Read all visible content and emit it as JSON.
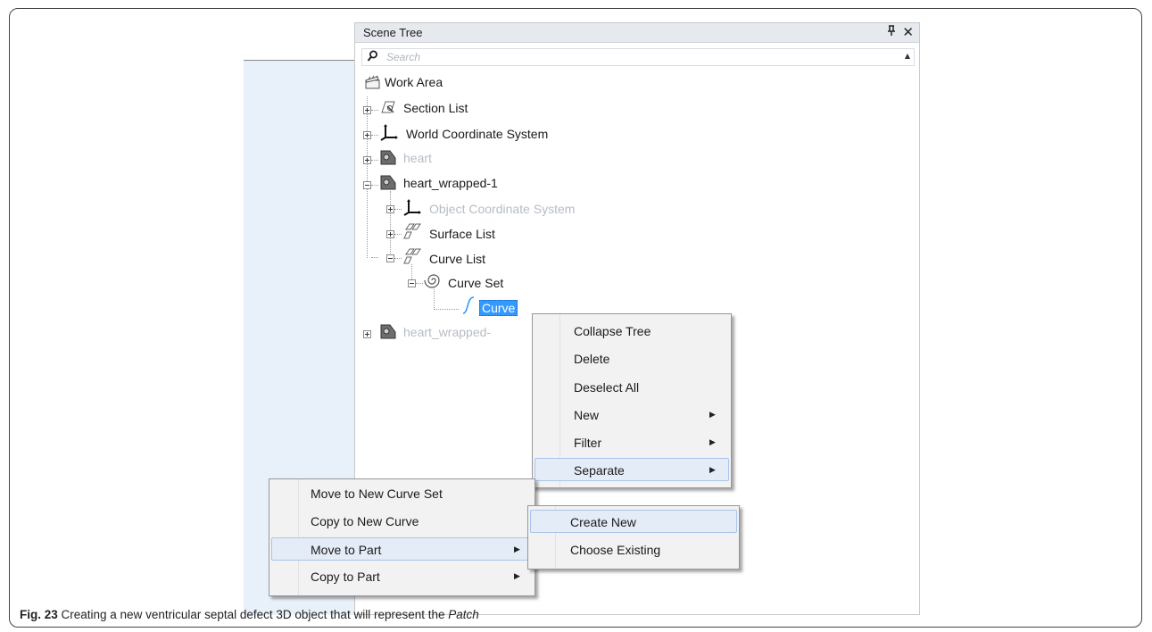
{
  "panel": {
    "title": "Scene Tree",
    "pin_glyph": "p",
    "close_glyph": "✕"
  },
  "search": {
    "placeholder": "Search"
  },
  "tree": {
    "work_area": "Work Area",
    "section_list": "Section List",
    "world_cs": "World Coordinate System",
    "heart": "heart",
    "heart_wrapped_1": "heart_wrapped-1",
    "object_cs": "Object Coordinate System",
    "surface_list": "Surface List",
    "curve_list": "Curve List",
    "curve_set": "Curve Set",
    "curve": "Curve",
    "heart_wrapped_2": "heart_wrapped-"
  },
  "context_menu": {
    "items": [
      "Collapse Tree",
      "Delete",
      "Deselect All",
      "New",
      "Filter",
      "Separate"
    ]
  },
  "separate_submenu": {
    "items": [
      "Move to New Curve Set",
      "Copy to New Curve",
      "Move to Part",
      "Copy to Part"
    ]
  },
  "part_submenu": {
    "items": [
      "Create New",
      "Choose Existing"
    ]
  },
  "caption": {
    "label": "Fig. 23",
    "text": " Creating a new ventricular septal defect 3D object that will represent the ",
    "emph": "Patch"
  },
  "colors": {
    "selection": "#3399ff",
    "menu_bg": "#f2f2f2",
    "dim_text": "#b6bcc4"
  }
}
